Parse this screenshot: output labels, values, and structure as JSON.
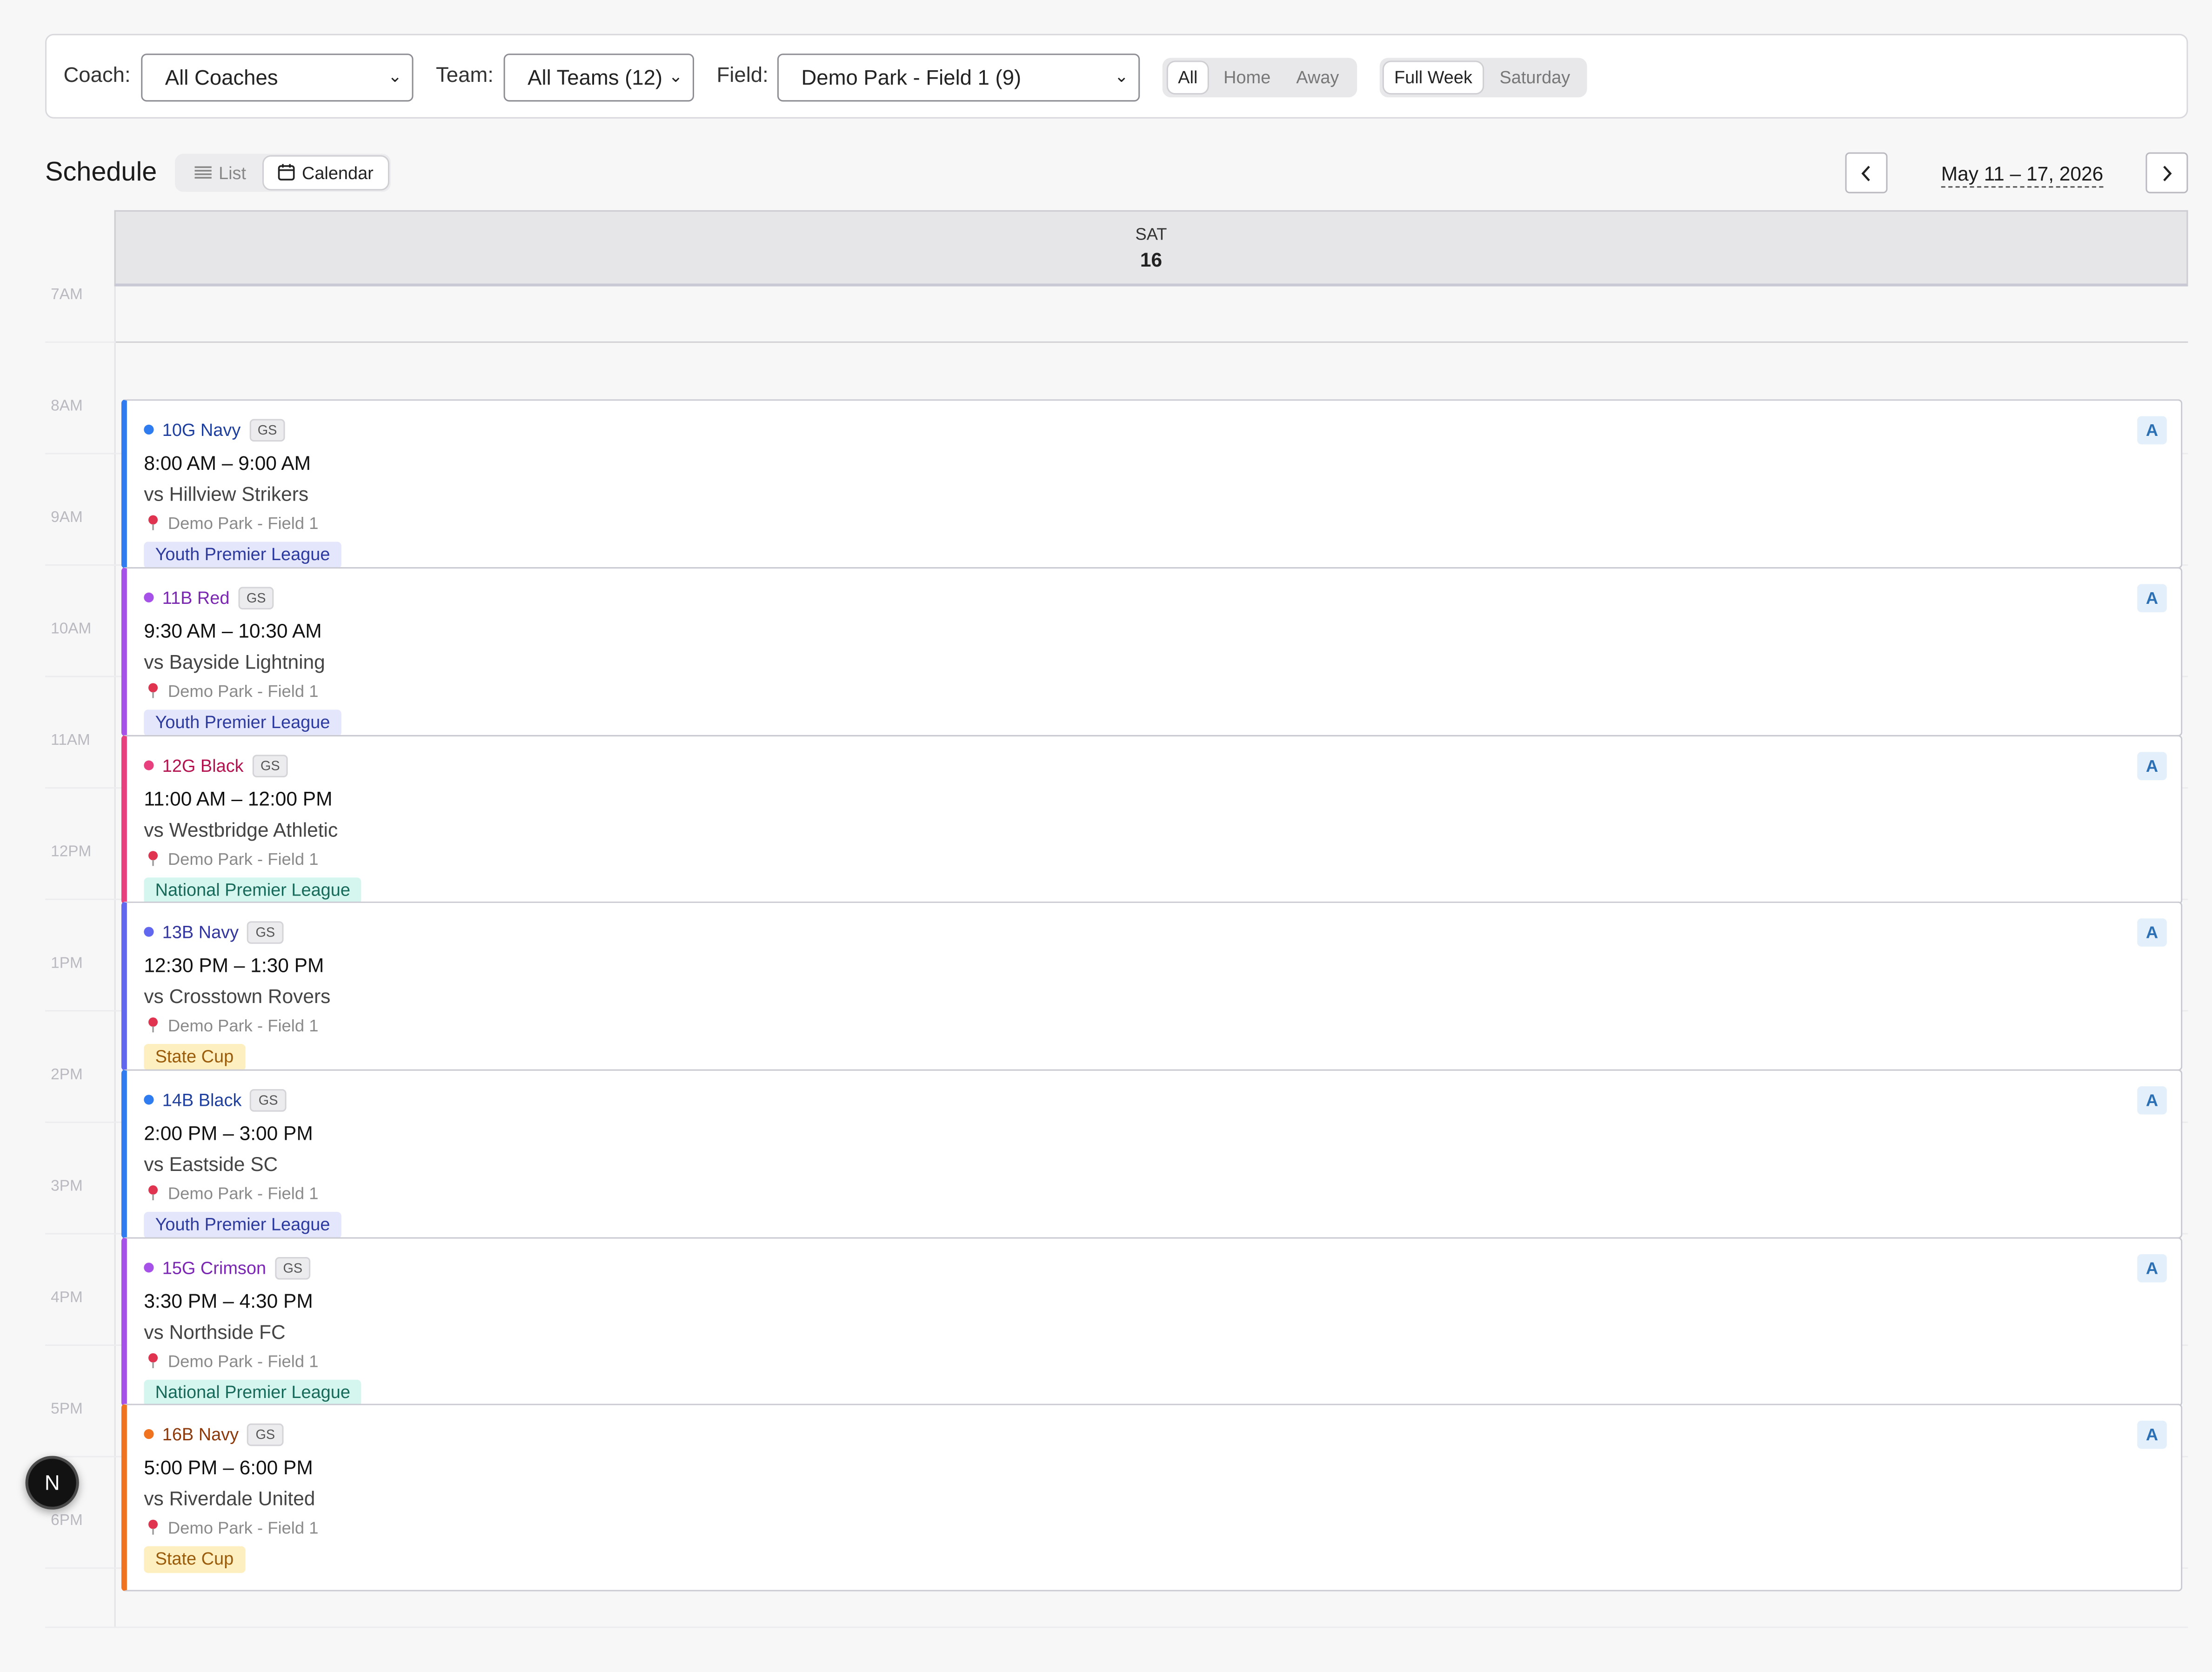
{
  "filters": {
    "coach_label": "Coach:",
    "coach_value": "All Coaches",
    "team_label": "Team:",
    "team_value": "All Teams (12)",
    "field_label": "Field:",
    "field_value": "Demo Park - Field 1 (9)",
    "venue_options": [
      "All",
      "Home",
      "Away"
    ],
    "venue_selected": "All",
    "period_options": [
      "Full Week",
      "Saturday"
    ],
    "period_selected": "Full Week"
  },
  "schedule": {
    "title": "Schedule",
    "view_list": "List",
    "view_calendar": "Calendar",
    "view_selected": "Calendar",
    "date_range": "May 11 – 17, 2026",
    "prev_icon": "chevron-left-icon",
    "next_icon": "chevron-right-icon"
  },
  "day": {
    "name": "SAT",
    "number": "16"
  },
  "hours": [
    "7AM",
    "8AM",
    "9AM",
    "10AM",
    "11AM",
    "12PM",
    "1PM",
    "2PM",
    "3PM",
    "4PM",
    "5PM",
    "6PM"
  ],
  "events": [
    {
      "team": "10G Navy",
      "tag": "GS",
      "time": "8:00 AM – 9:00 AM",
      "opponent": "vs Hillview Strikers",
      "location": "Demo Park - Field 1",
      "league": "Youth Premier League",
      "badge": "A",
      "color": "#2f7bf0",
      "text_color": "#1e3f9e",
      "league_bg": "#e4e6fb",
      "league_color": "#2d3a9e"
    },
    {
      "team": "11B Red",
      "tag": "GS",
      "time": "9:30 AM – 10:30 AM",
      "opponent": "vs Bayside Lightning",
      "location": "Demo Park - Field 1",
      "league": "Youth Premier League",
      "badge": "A",
      "color": "#a652e8",
      "text_color": "#7a26b3",
      "league_bg": "#e4e6fb",
      "league_color": "#2d3a9e"
    },
    {
      "team": "12G Black",
      "tag": "GS",
      "time": "11:00 AM – 12:00 PM",
      "opponent": "vs Westbridge Athletic",
      "location": "Demo Park - Field 1",
      "league": "National Premier League",
      "badge": "A",
      "color": "#e8407f",
      "text_color": "#b3124f",
      "league_bg": "#d4f6ef",
      "league_color": "#176a5a"
    },
    {
      "team": "13B Navy",
      "tag": "GS",
      "time": "12:30 PM – 1:30 PM",
      "opponent": "vs Crosstown Rovers",
      "location": "Demo Park - Field 1",
      "league": "State Cup",
      "badge": "A",
      "color": "#6167ee",
      "text_color": "#33359e",
      "league_bg": "#fdefc0",
      "league_color": "#9a5b0a"
    },
    {
      "team": "14B Black",
      "tag": "GS",
      "time": "2:00 PM – 3:00 PM",
      "opponent": "vs Eastside SC",
      "location": "Demo Park - Field 1",
      "league": "Youth Premier League",
      "badge": "A",
      "color": "#2f7bf0",
      "text_color": "#1e3f9e",
      "league_bg": "#e4e6fb",
      "league_color": "#2d3a9e"
    },
    {
      "team": "15G Crimson",
      "tag": "GS",
      "time": "3:30 PM – 4:30 PM",
      "opponent": "vs Northside FC",
      "location": "Demo Park - Field 1",
      "league": "National Premier League",
      "badge": "A",
      "color": "#a652e8",
      "text_color": "#7a26b3",
      "league_bg": "#d4f6ef",
      "league_color": "#176a5a"
    },
    {
      "team": "16B Navy",
      "tag": "GS",
      "time": "5:00 PM – 6:00 PM",
      "opponent": "vs Riverdale United",
      "location": "Demo Park - Field 1",
      "league": "State Cup",
      "badge": "A",
      "color": "#f07320",
      "text_color": "#8c3a0c",
      "league_bg": "#fdefc0",
      "league_color": "#9a5b0a"
    }
  ],
  "floating_badge": {
    "label": "N",
    "icon": "n-logo-icon"
  }
}
